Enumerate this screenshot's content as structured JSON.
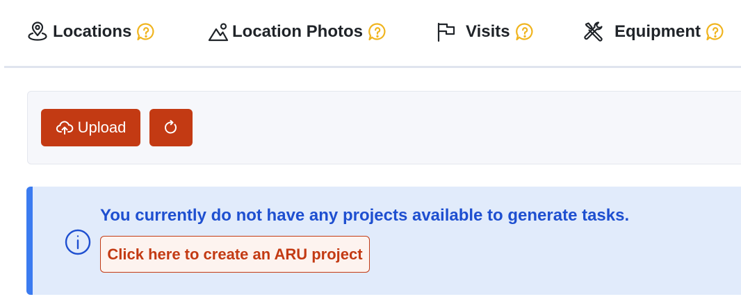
{
  "tabs": [
    {
      "label": "Locations",
      "icon": "map-pin-icon"
    },
    {
      "label": "Location Photos",
      "icon": "landscape-photo-icon"
    },
    {
      "label": "Visits",
      "icon": "flag-icon"
    },
    {
      "label": "Equipment",
      "icon": "tools-icon"
    }
  ],
  "help_icon": "question-bubble-icon",
  "toolbar": {
    "upload_label": "Upload",
    "upload_icon": "cloud-upload-icon",
    "refresh_icon": "refresh-icon"
  },
  "alert": {
    "message": "You currently do not have any projects available to generate tasks.",
    "link_label": "Click here to create an ARU project",
    "icon": "info-icon"
  },
  "colors": {
    "primary": "#c33a13",
    "help": "#f0b41e",
    "info_text": "#1e4fd0",
    "info_bg": "#e1ebfb",
    "info_bar": "#3b7bf0"
  }
}
